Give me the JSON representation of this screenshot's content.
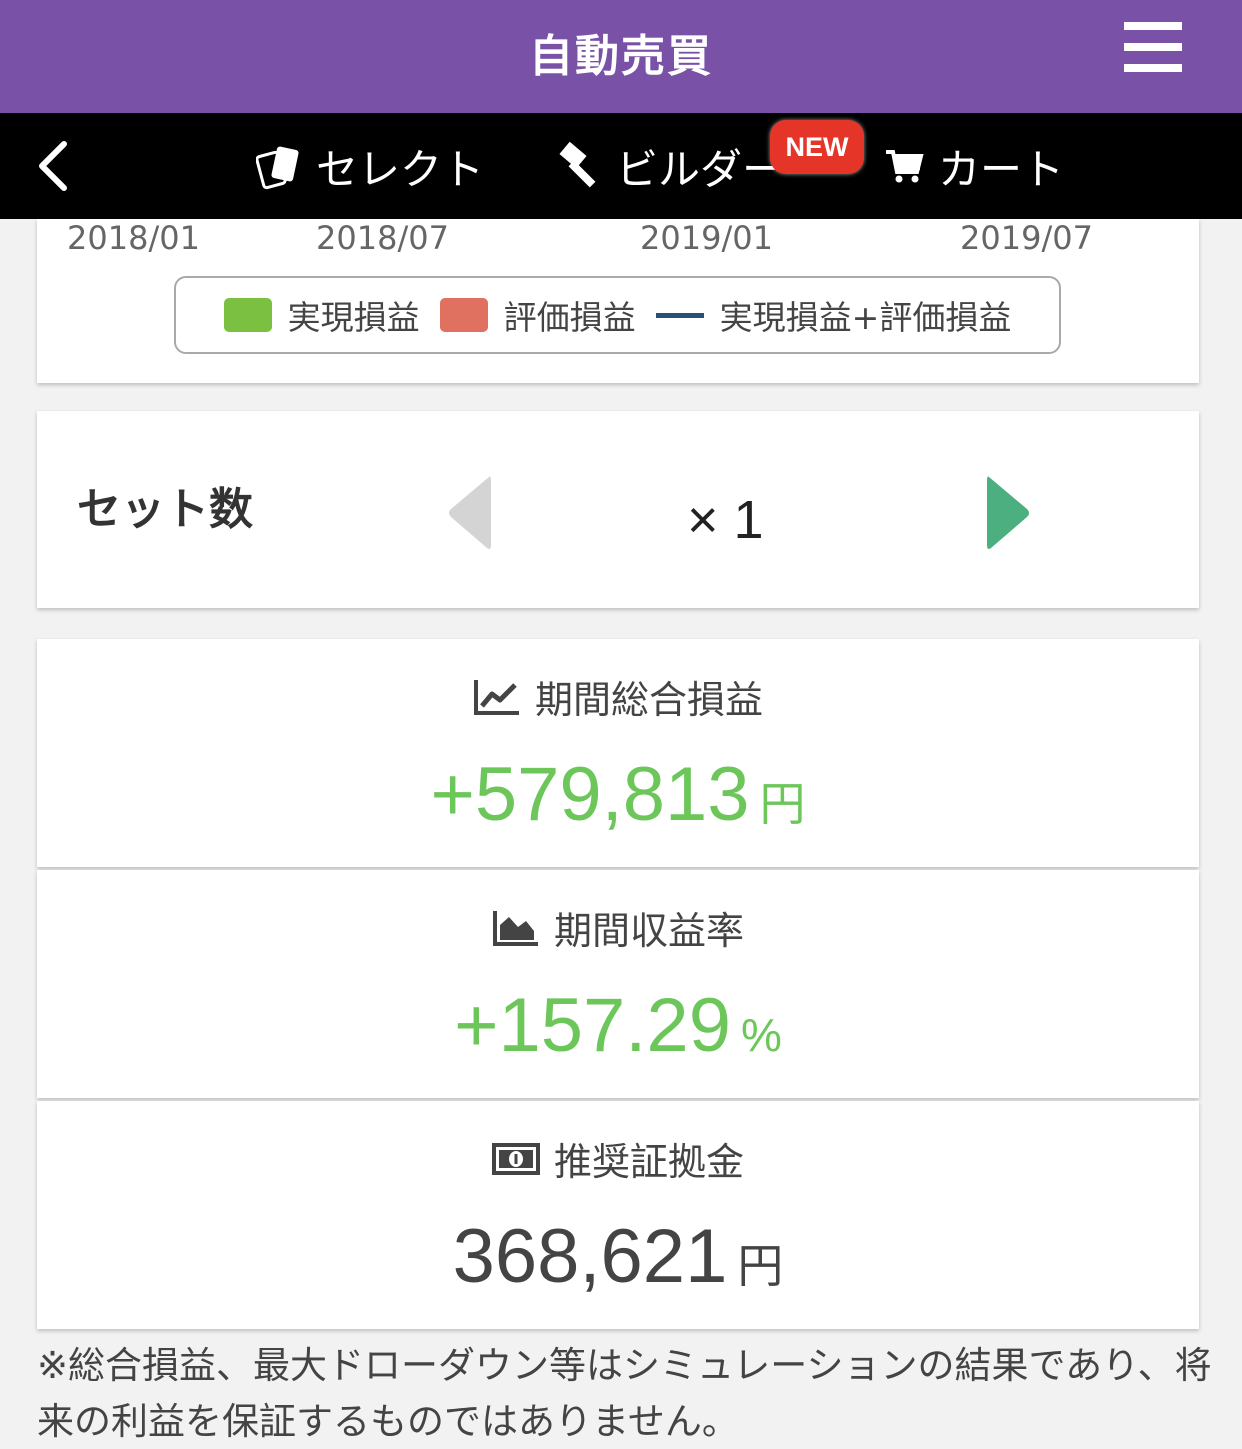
{
  "header": {
    "title": "自動売買"
  },
  "nav": {
    "select_label": "セレクト",
    "builder_label": "ビルダー",
    "new_badge": "NEW",
    "cart_label": "カート"
  },
  "chart": {
    "x_ticks": [
      "2018/01",
      "2018/07",
      "2019/01",
      "2019/07"
    ],
    "legend": [
      {
        "label": "実現損益",
        "color": "#7cc042"
      },
      {
        "label": "評価損益",
        "color": "#e07060"
      },
      {
        "label": "実現損益+評価損益",
        "color": "#2a4f7c"
      }
    ]
  },
  "sets": {
    "label": "セット数",
    "value": "× 1"
  },
  "stats": [
    {
      "title": "期間総合損益",
      "value": "+579,813",
      "unit": "円"
    },
    {
      "title": "期間収益率",
      "value": "+157.29",
      "unit": "%"
    },
    {
      "title": "推奨証拠金",
      "value": "368,621",
      "unit": "円"
    }
  ],
  "footnote": "※総合損益、最大ドローダウン等はシミュレーションの結果であり、将来の利益を保証するものではありません。"
}
